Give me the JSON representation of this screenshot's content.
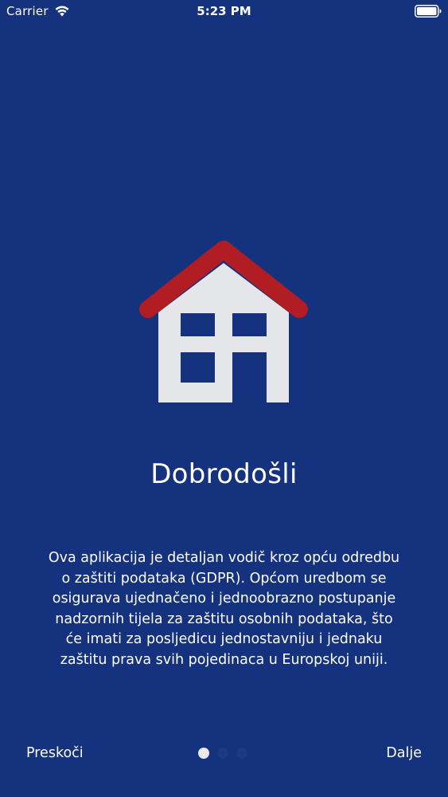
{
  "status_bar": {
    "carrier": "Carrier",
    "time": "5:23 PM",
    "wifi_icon": "wifi-icon",
    "battery_icon": "battery-icon"
  },
  "onboarding": {
    "illustration_icon": "house-icon",
    "title": "Dobrodošli",
    "description": "Ova aplikacija je detaljan vodič kroz opću odredbu o zaštiti podataka (GDPR). Općom uredbom se osigurava ujednačeno i jednoobrazno postupanje nadzornih tijela za zaštitu osobnih podataka, što će imati za posljedicu jednostavniju i jednaku zaštitu prava svih pojedinaca u Europskoj uniji.",
    "page_count": 3,
    "current_page": 1
  },
  "controls": {
    "skip_label": "Preskoči",
    "next_label": "Dalje"
  },
  "colors": {
    "background": "#15327f",
    "roof": "#b11d22",
    "house_wall": "#e5e6ea",
    "window": "#15327f",
    "text": "#ffffff",
    "dot_active": "#e9ebf0",
    "dot_inactive": "#1a3a86"
  }
}
